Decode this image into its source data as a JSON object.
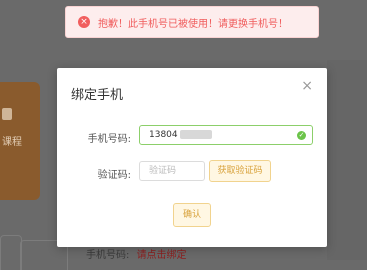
{
  "toast": {
    "icon": "error-circle-icon",
    "message": "抱歉！此手机号已被使用！请更换手机号！"
  },
  "dialog": {
    "title": "绑定手机",
    "close_icon": "close-icon",
    "phone_label": "手机号码:",
    "phone_value": "13804",
    "code_label": "验证码:",
    "code_placeholder": "验证码",
    "get_code_label": "获取验证码",
    "confirm_label": "确认"
  },
  "background": {
    "card_label": "课程",
    "phone_label": "手机号码:",
    "phone_value": "请点击绑定"
  },
  "colors": {
    "error": "#f05c5c",
    "success": "#6cc44a",
    "accent": "#d8a23b"
  }
}
